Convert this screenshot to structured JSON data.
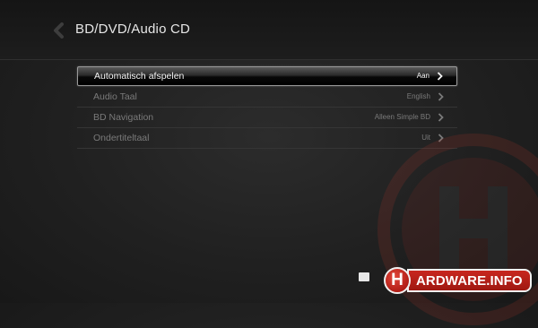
{
  "header": {
    "title": "BD/DVD/Audio CD",
    "back_icon": "chevron-left-icon"
  },
  "menu": {
    "items": [
      {
        "label": "Automatisch afspelen",
        "value": "Aan",
        "selected": true
      },
      {
        "label": "Audio Taal",
        "value": "English",
        "selected": false
      },
      {
        "label": "BD Navigation",
        "value": "Alleen Simple BD",
        "selected": false
      },
      {
        "label": "Ondertiteltaal",
        "value": "Uit",
        "selected": false
      }
    ]
  },
  "footer": {
    "home_icon": "home-icon",
    "logo_letter": "H",
    "logo_text": "ARDWARE.INFO"
  },
  "colors": {
    "background": "#202020",
    "selected_text": "#f4f4f4",
    "inactive_text": "#7a7a7a",
    "logo_red": "#c8271f"
  }
}
